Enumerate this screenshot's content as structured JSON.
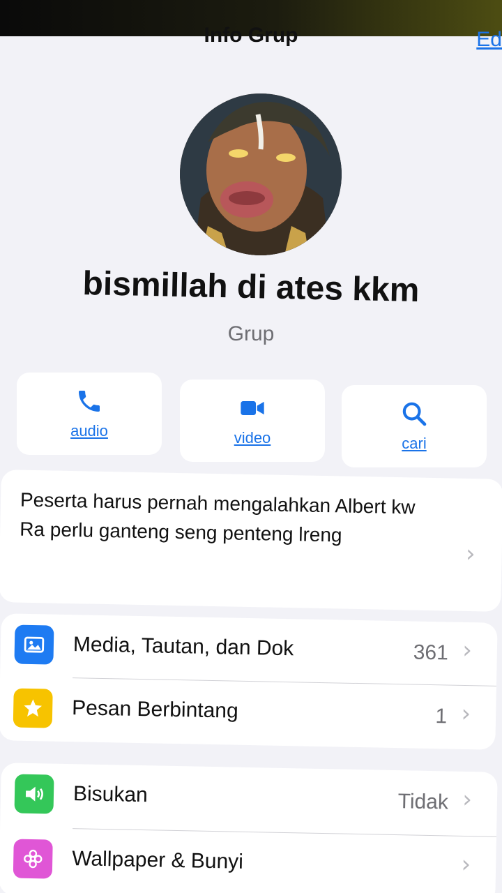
{
  "nav": {
    "back_label": "",
    "title": "Info Grup",
    "edit_label": "Ed"
  },
  "group": {
    "name": "bismillah di ates kkm",
    "subtitle": "Grup"
  },
  "actions": [
    {
      "label": "audio",
      "icon": "phone-icon"
    },
    {
      "label": "video",
      "icon": "video-camera-icon"
    },
    {
      "label": "cari",
      "icon": "search-icon"
    }
  ],
  "description": {
    "line1": "Peserta harus pernah mengalahkan Albert kw",
    "line2": "Ra perlu ganteng seng penteng lreng"
  },
  "list1": [
    {
      "label": "Media, Tautan, dan Dok",
      "value": "361",
      "icon": "photo-icon",
      "color": "#1e7bf2"
    },
    {
      "label": "Pesan Berbintang",
      "value": "1",
      "icon": "star-icon",
      "color": "#f7c300"
    }
  ],
  "list2": [
    {
      "label": "Bisukan",
      "value": "Tidak",
      "icon": "speaker-icon",
      "color": "#34c759"
    },
    {
      "label": "Wallpaper & Bunyi",
      "value": "",
      "icon": "flower-icon",
      "color": "#e056d6"
    }
  ],
  "colors": {
    "accent": "#1a73e8",
    "background": "#f2f2f7"
  }
}
